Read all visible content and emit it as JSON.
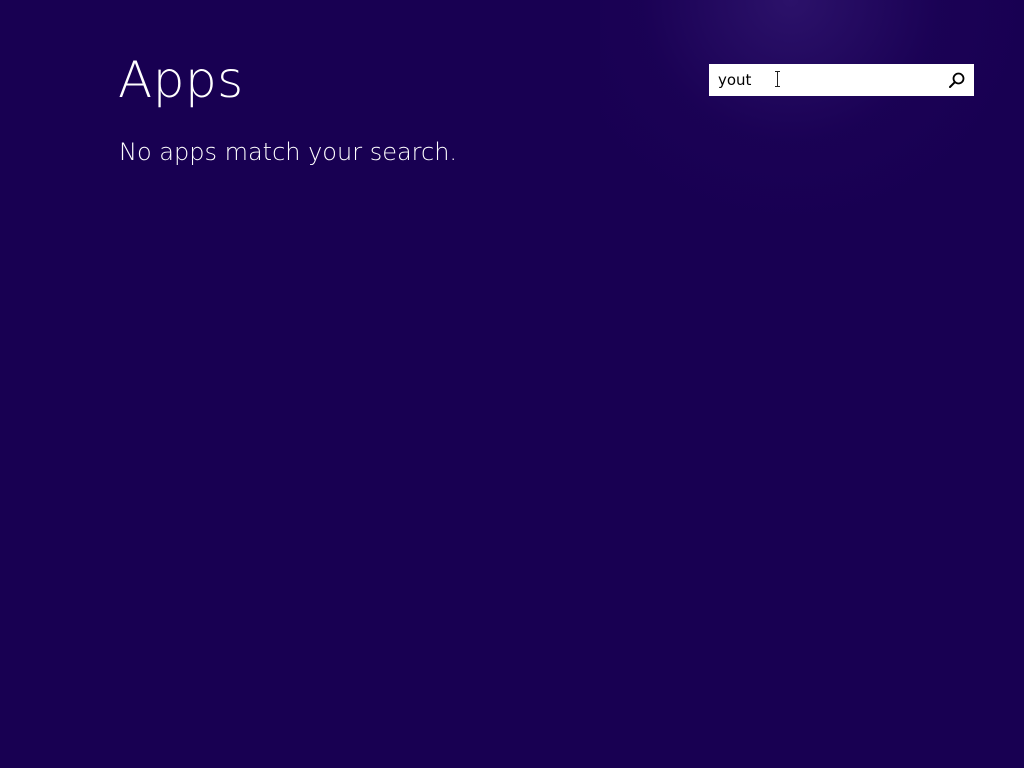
{
  "page": {
    "title": "Apps",
    "empty_message": "No apps match your search."
  },
  "search": {
    "value": "yout",
    "button_icon": "search-icon"
  },
  "colors": {
    "background": "#180052",
    "text": "#ffffff",
    "search_box": "#ffffff"
  }
}
